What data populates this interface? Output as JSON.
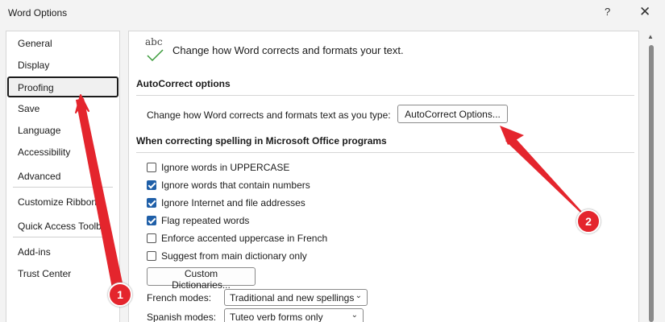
{
  "window": {
    "title": "Word Options",
    "help_label": "?",
    "close_label": "✕"
  },
  "sidebar": {
    "items": [
      {
        "label": "General"
      },
      {
        "label": "Display"
      },
      {
        "label": "Proofing",
        "selected": true
      },
      {
        "label": "Save"
      },
      {
        "label": "Language"
      },
      {
        "label": "Accessibility"
      },
      {
        "label": "Advanced"
      },
      {
        "label": "Customize Ribbon"
      },
      {
        "label": "Quick Access Toolbar"
      },
      {
        "label": "Add-ins"
      },
      {
        "label": "Trust Center"
      }
    ]
  },
  "header": {
    "icon": "abc-check-icon",
    "icon_text": "abc",
    "text": "Change how Word corrects and formats your text."
  },
  "autocorrect": {
    "title": "AutoCorrect options",
    "description": "Change how Word corrects and formats text as you type:",
    "button_label": "AutoCorrect Options..."
  },
  "spelling": {
    "title": "When correcting spelling in Microsoft Office programs",
    "options": [
      {
        "label": "Ignore words in UPPERCASE",
        "checked": false
      },
      {
        "label": "Ignore words that contain numbers",
        "checked": true
      },
      {
        "label": "Ignore Internet and file addresses",
        "checked": true
      },
      {
        "label": "Flag repeated words",
        "checked": true
      },
      {
        "label": "Enforce accented uppercase in French",
        "checked": false
      },
      {
        "label": "Suggest from main dictionary only",
        "checked": false
      }
    ],
    "custom_dictionaries_label": "Custom Dictionaries...",
    "french_modes": {
      "label": "French modes:",
      "value": "Traditional and new spellings"
    },
    "spanish_modes": {
      "label": "Spanish modes:",
      "value": "Tuteo verb forms only"
    }
  },
  "annotations": [
    {
      "number": "1"
    },
    {
      "number": "2"
    }
  ],
  "colors": {
    "accent": "#1f5fa8",
    "annotation": "#e4252d"
  }
}
